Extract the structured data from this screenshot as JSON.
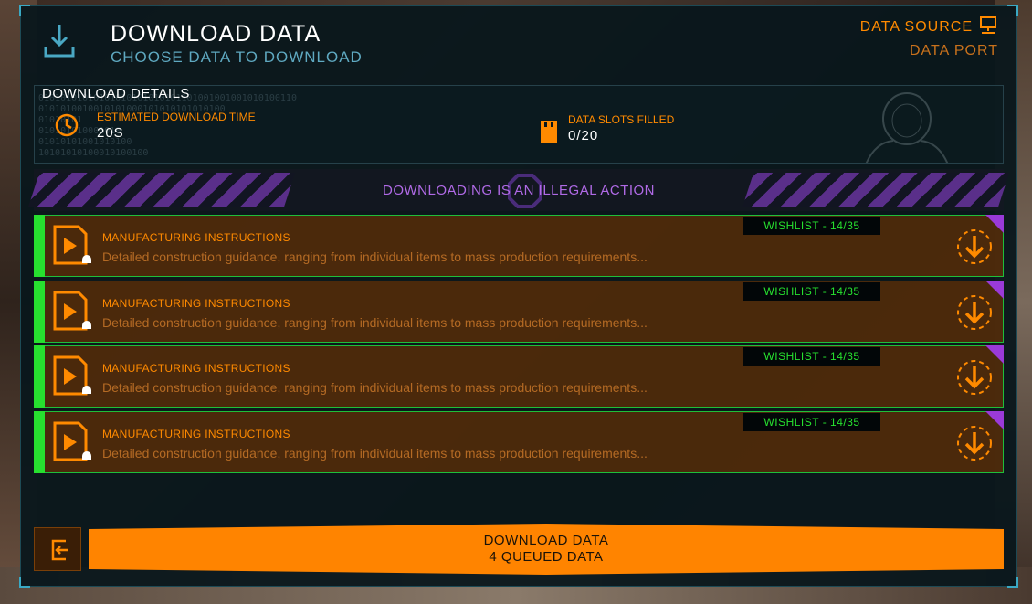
{
  "header": {
    "title": "DOWNLOAD DATA",
    "subtitle": "CHOOSE DATA TO DOWNLOAD",
    "source_label": "DATA SOURCE",
    "source_value": "DATA PORT"
  },
  "details": {
    "title": "DOWNLOAD DETAILS",
    "binary_text": "01010101010101010101010101101001001001010100110\n0101010010010101000101010101010100\n01010101\n010101010001010\n01010101001010100\n10101010100010100100",
    "estimated_label": "ESTIMATED DOWNLOAD TIME",
    "estimated_value": "20S",
    "slots_label": "DATA SLOTS FILLED",
    "slots_value": "0/20"
  },
  "warning": {
    "text": "DOWNLOADING IS AN ILLEGAL ACTION"
  },
  "items": [
    {
      "title": "MANUFACTURING INSTRUCTIONS",
      "description": "Detailed construction guidance, ranging from individual items to mass production requirements...",
      "wishlist": "WISHLIST - 14/35"
    },
    {
      "title": "MANUFACTURING INSTRUCTIONS",
      "description": "Detailed construction guidance, ranging from individual items to mass production requirements...",
      "wishlist": "WISHLIST - 14/35"
    },
    {
      "title": "MANUFACTURING INSTRUCTIONS",
      "description": "Detailed construction guidance, ranging from individual items to mass production requirements...",
      "wishlist": "WISHLIST - 14/35"
    },
    {
      "title": "MANUFACTURING INSTRUCTIONS",
      "description": "Detailed construction guidance, ranging from individual items to mass production requirements...",
      "wishlist": "WISHLIST - 14/35"
    }
  ],
  "footer": {
    "button_label": "DOWNLOAD DATA",
    "button_sublabel": "4 QUEUED DATA"
  },
  "colors": {
    "accent": "#ff8400",
    "wishlist_green": "#27e02f",
    "warning_purple": "#b06ae6",
    "panel": "#08161c",
    "subtitle_blue": "#5fa9c1"
  },
  "icons": {
    "header": "download-tray-icon",
    "source": "monitor-icon",
    "time": "clock-icon",
    "slots": "data-chip-icon",
    "warning": "octagon-warning-icon",
    "item": "play-document-icon",
    "item_download": "download-circle-icon",
    "exit": "exit-icon"
  }
}
